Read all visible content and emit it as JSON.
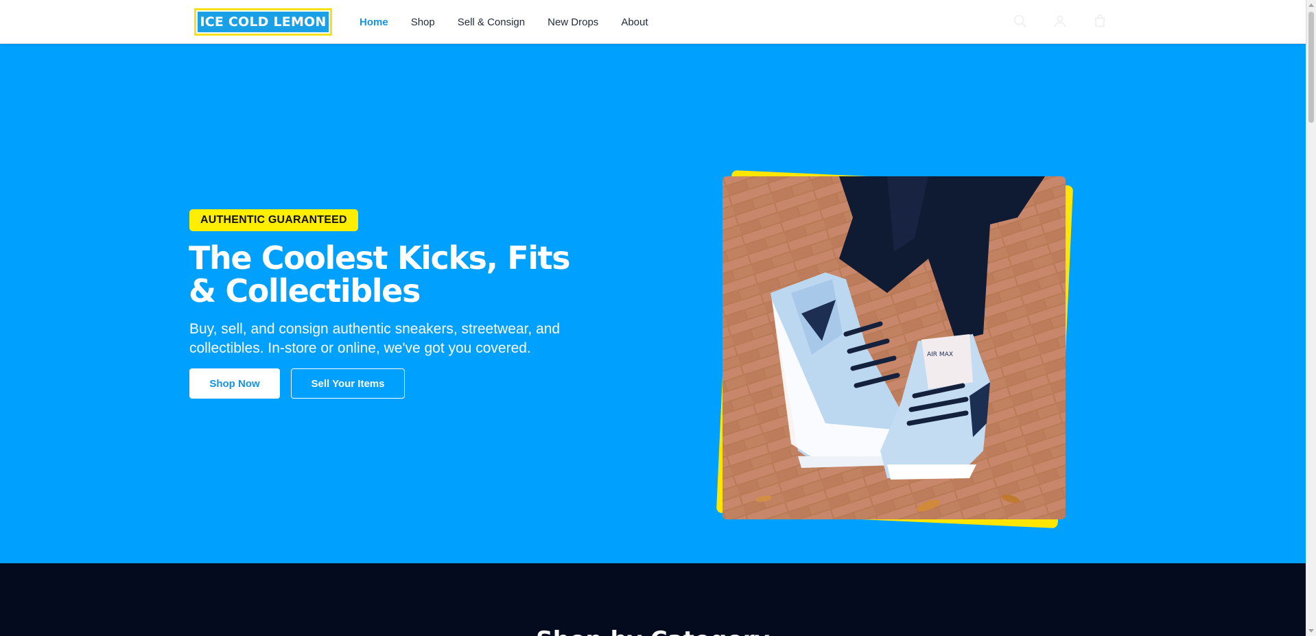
{
  "brand": {
    "logo_text": "ICE COLD LEMON"
  },
  "nav": {
    "items": [
      {
        "label": "Home",
        "active": true
      },
      {
        "label": "Shop",
        "active": false
      },
      {
        "label": "Sell & Consign",
        "active": false
      },
      {
        "label": "New Drops",
        "active": false
      },
      {
        "label": "About",
        "active": false
      }
    ]
  },
  "header_icons": [
    "search-icon",
    "user-icon",
    "cart-icon"
  ],
  "hero": {
    "badge": "AUTHENTIC GUARANTEED",
    "title": "The Coolest Kicks, Fits & Collectibles",
    "subtitle": "Buy, sell, and consign authentic sneakers, streetwear, and collectibles. In-store or online, we've got you covered.",
    "primary_button": "Shop Now",
    "secondary_button": "Sell Your Items",
    "image_tongue_text": "AIR MAX"
  },
  "colors": {
    "hero_bg": "#00a0ff",
    "accent_yellow": "#ffee00",
    "nav_active": "#1493e0",
    "dark_section_bg": "#050b1e"
  },
  "next_section": {
    "title": "Shop by Category"
  }
}
